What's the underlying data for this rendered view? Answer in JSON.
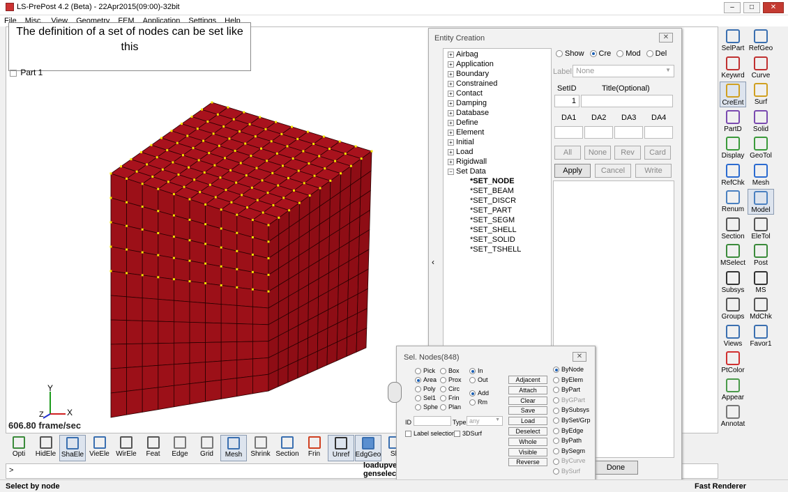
{
  "window": {
    "title": "LS-PrePost 4.2 (Beta) - 22Apr2015(09:00)-32bit"
  },
  "menu": [
    "File",
    "Misc.",
    "View",
    "Geometry",
    "FEM",
    "Application",
    "Settings",
    "Help"
  ],
  "annotation": "The definition of a set of nodes can be set like this",
  "part_label": "Part 1",
  "fps": "606.80 frame/sec",
  "entity_creation": {
    "title": "Entity Creation",
    "tree": [
      "Airbag",
      "Application",
      "Boundary",
      "Constrained",
      "Contact",
      "Damping",
      "Database",
      "Define",
      "Element",
      "Initial",
      "Load",
      "Rigidwall",
      "Set Data"
    ],
    "set_items": [
      "*SET_NODE",
      "*SET_BEAM",
      "*SET_DISCR",
      "*SET_PART",
      "*SET_SEGM",
      "*SET_SHELL",
      "*SET_SOLID",
      "*SET_TSHELL"
    ],
    "modes": [
      "Show",
      "Cre",
      "Mod",
      "Del"
    ],
    "label_caption": "Label:",
    "label_value": "None",
    "setid_caption": "SetID",
    "title_caption": "Title(Optional)",
    "setid_value": "1",
    "da": [
      "DA1",
      "DA2",
      "DA3",
      "DA4"
    ],
    "row_btns": [
      "All",
      "None",
      "Rev",
      "Card"
    ],
    "action_btns": [
      "Apply",
      "Cancel",
      "Write"
    ],
    "done": "Done"
  },
  "sel_nodes": {
    "title": "Sel. Nodes(848)",
    "col1": [
      "Pick",
      "Area",
      "Poly",
      "Sel1",
      "Sphe"
    ],
    "col2": [
      "Box",
      "Prox",
      "Circ",
      "Frin",
      "Plan"
    ],
    "inout": [
      "In",
      "Out"
    ],
    "addrm": [
      "Add",
      "Rm"
    ],
    "buttons": [
      "Adjacent",
      "Attach",
      "Clear",
      "Save",
      "Load",
      "Deselect",
      "Whole",
      "Visible",
      "Reverse"
    ],
    "by": [
      "ByNode",
      "ByElem",
      "ByPart",
      "ByGPart",
      "BySubsys",
      "BySet/Grp",
      "ByEdge",
      "ByPath",
      "BySegm",
      "ByCurve",
      "BySurf"
    ],
    "id_label": "ID",
    "type_label": "Type",
    "type_value": "any",
    "label_sel": "Label selection",
    "surf3d": "3DSurf"
  },
  "bottom_tools": [
    "Opti",
    "HidEle",
    "ShaEle",
    "VieEle",
    "WirEle",
    "Feat",
    "Edge",
    "Grid",
    "Mesh",
    "Shrink",
    "Section",
    "Frin",
    "Unref",
    "EdgGeo",
    "Sh"
  ],
  "right_tools": [
    [
      "SelPart",
      "RefGeo"
    ],
    [
      "Keywrd",
      "Curve"
    ],
    [
      "CreEnt",
      "Surf"
    ],
    [
      "PartD",
      "Solid"
    ],
    [
      "Display",
      "GeoTol"
    ],
    [
      "RefChk",
      "Mesh"
    ],
    [
      "Renum",
      "Model"
    ],
    [
      "Section",
      "EleTol"
    ],
    [
      "MSelect",
      "Post"
    ],
    [
      "Subsys",
      "MS"
    ],
    [
      "Groups",
      "MdChk"
    ],
    [
      "Views",
      "Favor1"
    ],
    [
      "PtColor",
      ""
    ],
    [
      "Appear",
      ""
    ],
    [
      "Annotat",
      ""
    ]
  ],
  "cmd_text": [
    "loadupve",
    "genselect"
  ],
  "prompt": ">",
  "status_left": "Select by node",
  "status_right": "Fast Renderer",
  "axes": {
    "y": "Y",
    "z": "Z",
    "x": "X"
  }
}
